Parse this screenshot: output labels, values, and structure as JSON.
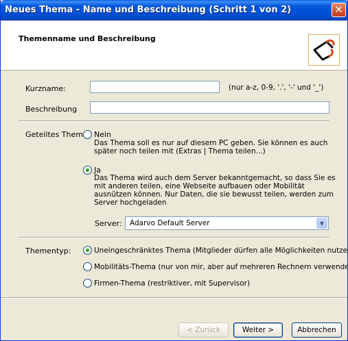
{
  "window": {
    "title": "Neues Thema - Name und Beschreibung (Schritt 1 von 2)",
    "close_glyph": "✕"
  },
  "header": {
    "title": "Themenname und Beschreibung",
    "logo_icon": "boomerang-logo-icon"
  },
  "form": {
    "kurzname_label": "Kurzname:",
    "kurzname_value": "",
    "kurzname_hint": "(nur  a-z, 0-9, '.', '-' und '_')",
    "beschreibung_label": "Beschreibung",
    "beschreibung_value": ""
  },
  "sharing": {
    "label": "Geteiltes Thema",
    "option_nein": {
      "label": "Nein",
      "description_lines": [
        "Das Thema soll es nur auf diesem PC geben. Sie können es auch",
        "später noch teilen mit (Extras | Thema teilen...)"
      ],
      "selected": false
    },
    "option_ja": {
      "label": "Ja",
      "description_lines": [
        "Das Thema wird auch dem Server bekanntgemacht, so dass Sie es",
        "mit anderen teilen, eine Webseite aufbauen oder Mobilität",
        "ausnützen können. Nur Daten, die sie bewusst teilen, werden zum",
        "Server hochgeladen"
      ],
      "selected": true
    },
    "server_label": "Server:",
    "server_value": "Adarvo Default Server",
    "server_arrow": "▼"
  },
  "theme_type": {
    "label": "Thementyp:",
    "options": [
      {
        "label": "Uneingeschränktes Thema (Mitglieder dürfen alle Möglichkeiten nutzen)",
        "selected": true
      },
      {
        "label": "Mobilitäts-Thema (nur von mir, aber auf mehreren Rechnern verwendet)",
        "selected": false
      },
      {
        "label": "Firmen-Thema (restriktiver, mit Supervisor)",
        "selected": false
      }
    ]
  },
  "buttons": {
    "back": "< Zurück",
    "next": "Weiter >",
    "cancel": "Abbrechen"
  },
  "colors": {
    "titlebar": "#0054E3",
    "dialog_bg": "#ECE9D8",
    "radio_dot": "#21A121",
    "logo_border": "#E2AE4E"
  }
}
